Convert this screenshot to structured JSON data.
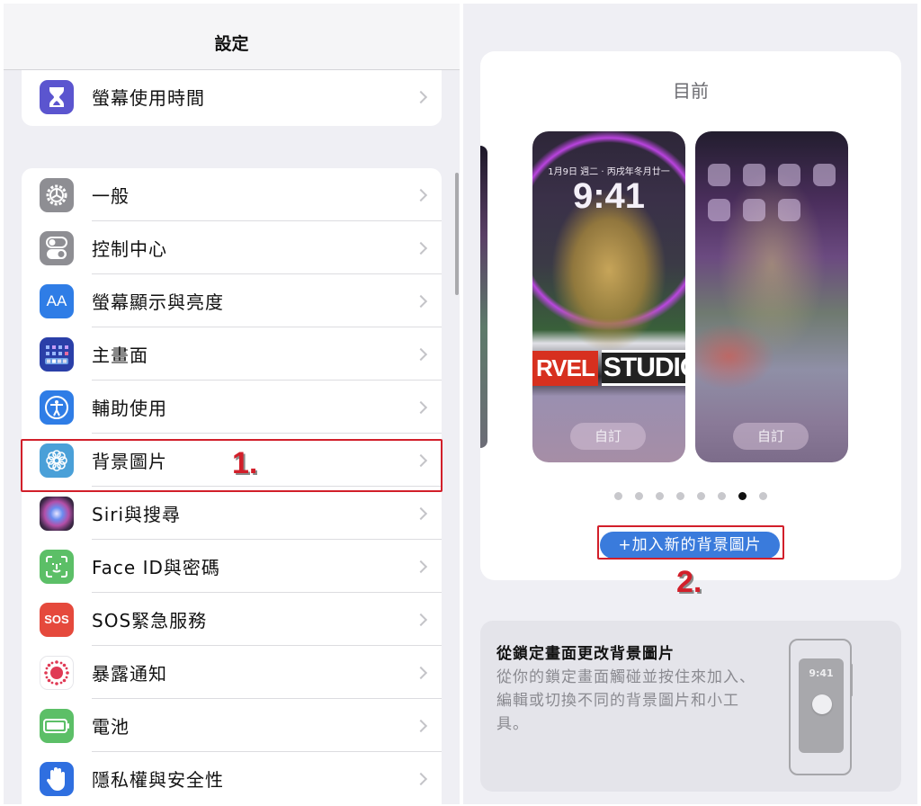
{
  "left_pane": {
    "nav_title": "設定",
    "group1": [
      {
        "label": "螢幕使用時間",
        "icon": "hourglass-icon",
        "color": "#5b55cf"
      }
    ],
    "group2": [
      {
        "label": "一般",
        "icon": "gear-icon",
        "color": "#8e8e93"
      },
      {
        "label": "控制中心",
        "icon": "toggles-icon",
        "color": "#8e8e93"
      },
      {
        "label": "螢幕顯示與亮度",
        "icon": "text-size-icon",
        "color": "#2f7de6"
      },
      {
        "label": "主畫面",
        "icon": "home-screen-grid-icon",
        "color": "#2a3fa8"
      },
      {
        "label": "輔助使用",
        "icon": "accessibility-icon",
        "color": "#2f7de6"
      },
      {
        "label": "背景圖片",
        "icon": "wallpaper-flower-icon",
        "color": "#4aa0d8"
      },
      {
        "label": "Siri與搜尋",
        "icon": "siri-icon",
        "color": "#2a2030"
      },
      {
        "label": "Face ID與密碼",
        "icon": "face-id-icon",
        "color": "#5cbf67"
      },
      {
        "label": "SOS緊急服務",
        "icon": "sos-icon",
        "color": "#e5493c",
        "icon_text": "SOS"
      },
      {
        "label": "暴露通知",
        "icon": "exposure-notification-icon",
        "color": "#ffffff"
      },
      {
        "label": "電池",
        "icon": "battery-icon",
        "color": "#5cbf67"
      },
      {
        "label": "隱私權與安全性",
        "icon": "hand-icon",
        "color": "#2f6fe0"
      }
    ],
    "annotation_step": "1."
  },
  "right_pane": {
    "current_label": "目前",
    "lock_screen": {
      "date": "1月9日 週二 · 丙戌年冬月廿一",
      "time": "9:41",
      "marvel_red": "RVEL",
      "marvel_studios": "STUDIOS",
      "customize_label": "自訂"
    },
    "home_screen": {
      "app_icon_count": 7,
      "customize_label": "自訂"
    },
    "pager": {
      "total": 8,
      "active_index": 6
    },
    "add_button_label": "+加入新的背景圖片",
    "annotation_step": "2.",
    "tip": {
      "title": "從鎖定畫面更改背景圖片",
      "body": "從你的鎖定畫面觸碰並按住來加入、編輯或切換不同的背景圖片和小工具。",
      "illustration_time": "9:41"
    }
  },
  "colors": {
    "annotation_red": "#d21f2a",
    "button_blue": "#3a7bdc",
    "background": "#efeff4"
  }
}
